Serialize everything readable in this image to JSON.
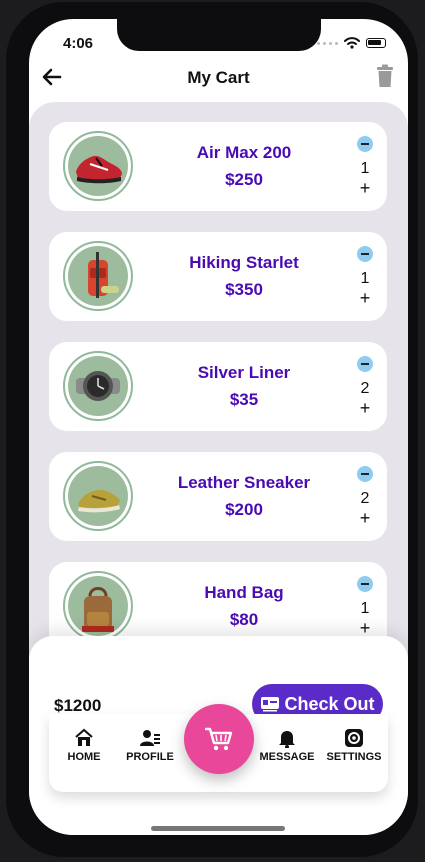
{
  "status_bar": {
    "time": "4:06"
  },
  "header": {
    "title": "My Cart"
  },
  "cart": {
    "items": [
      {
        "name": "Air Max 200",
        "price": "$250",
        "quantity": "1"
      },
      {
        "name": "Hiking Starlet",
        "price": "$350",
        "quantity": "1"
      },
      {
        "name": "Silver Liner",
        "price": "$35",
        "quantity": "2"
      },
      {
        "name": "Leather Sneaker",
        "price": "$200",
        "quantity": "2"
      },
      {
        "name": "Hand Bag",
        "price": "$80",
        "quantity": "1"
      }
    ],
    "increment_symbol": "+"
  },
  "summary": {
    "total": "$1200",
    "checkout_label": "Check Out"
  },
  "nav": {
    "items": [
      {
        "label": "HOME",
        "icon": "home-icon"
      },
      {
        "label": "PROFILE",
        "icon": "profile-icon"
      },
      {
        "label": "MESSAGE",
        "icon": "bell-icon"
      },
      {
        "label": "SETTINGS",
        "icon": "settings-icon"
      }
    ],
    "fab_icon": "cart-icon"
  },
  "colors": {
    "accent_purple": "#5a2bc8",
    "item_text": "#4b0bb3",
    "fab_pink": "#e8479a",
    "minus_blue": "#8ecdf0",
    "panel_bg": "#e6e4ea"
  }
}
